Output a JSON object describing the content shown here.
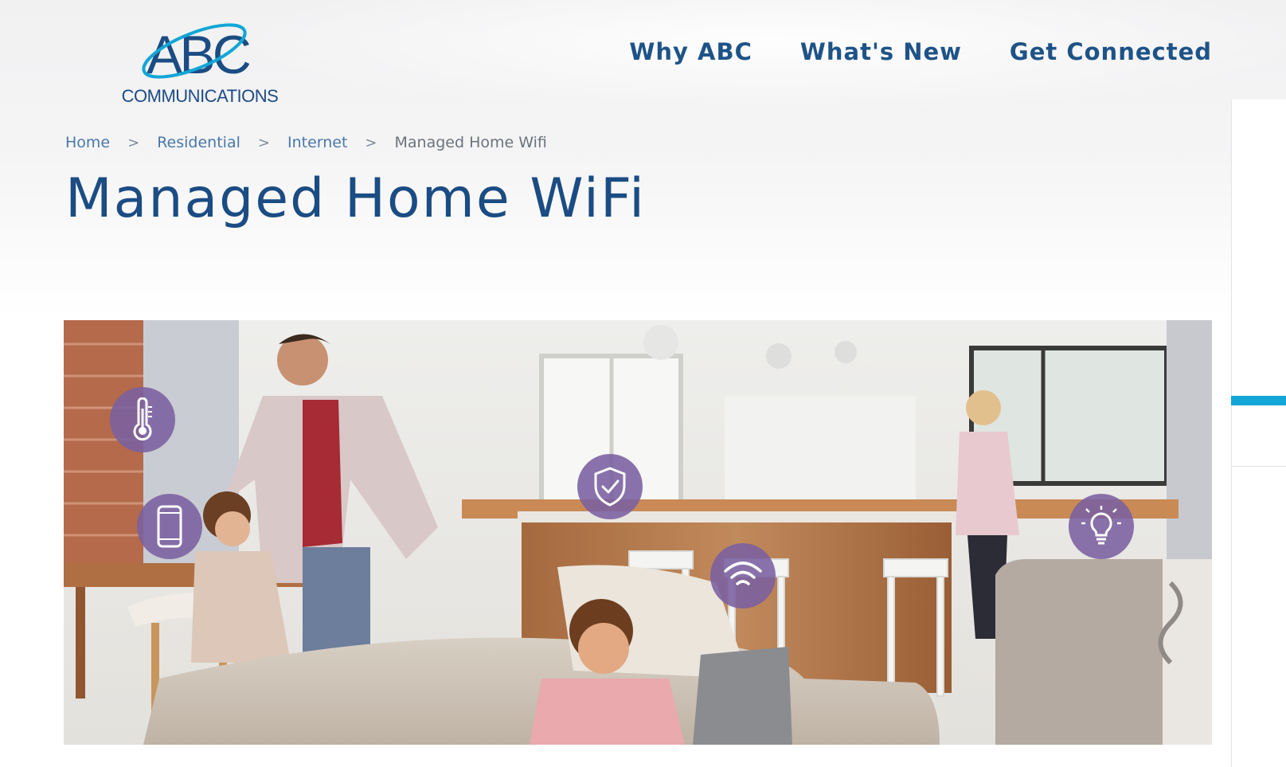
{
  "logo": {
    "mark": "ABC",
    "subtitle": "COMMUNICATIONS"
  },
  "nav": {
    "items": [
      {
        "label": "Why ABC"
      },
      {
        "label": "What's New"
      },
      {
        "label": "Get Connected"
      }
    ]
  },
  "breadcrumb": {
    "separator": ">",
    "items": [
      {
        "label": "Home"
      },
      {
        "label": "Residential"
      },
      {
        "label": "Internet"
      },
      {
        "label": "Managed Home Wifi"
      }
    ]
  },
  "page": {
    "title": "Managed Home WiFi"
  },
  "hero": {
    "icons": [
      "thermometer-icon",
      "smartphone-icon",
      "shield-check-icon",
      "wifi-icon",
      "lightbulb-icon"
    ]
  },
  "colors": {
    "brand": "#1b4c83",
    "accent": "#12a6d6",
    "icon_bubble": "#7a60a0"
  }
}
